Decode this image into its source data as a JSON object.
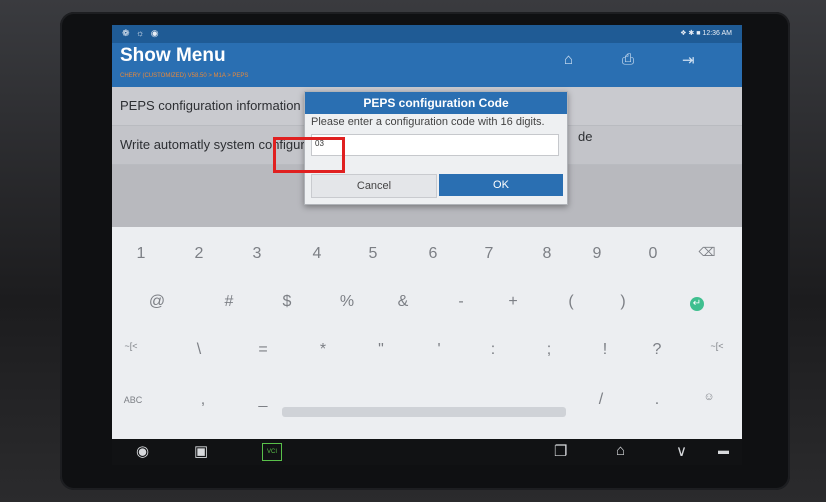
{
  "statusbar": {
    "left_icons": "❁ ☼ ◉",
    "time": "12:36 AM",
    "right_icons": "❖ ✱ ■"
  },
  "header": {
    "title": "Show Menu",
    "breadcrumb": "CHERY (CUSTOMIZED) V58.50 > M1A > PEPS",
    "icons": [
      "home-icon",
      "print-icon",
      "exit-icon"
    ]
  },
  "menu": {
    "items": [
      {
        "label": "PEPS configuration information"
      },
      {
        "label": "Write automatly system configuration"
      }
    ],
    "behind_text": "de"
  },
  "dialog": {
    "title": "PEPS configuration Code",
    "prompt": "Please enter a configuration code with 16 digits.",
    "input_value": "03",
    "cancel_label": "Cancel",
    "ok_label": "OK"
  },
  "keyboard": {
    "row1": [
      "1",
      "2",
      "3",
      "4",
      "5",
      "6",
      "7",
      "8",
      "9",
      "0",
      "⌫"
    ],
    "row2": [
      "@",
      "#",
      "$",
      "%",
      "&",
      "-",
      "+",
      "(",
      ")",
      "↵"
    ],
    "row3": [
      "~[<",
      "\\",
      "=",
      "*",
      "\"",
      "'",
      ":",
      ";",
      "!",
      "?",
      "~[<"
    ],
    "row4": {
      "left": "ABC",
      "comma": ",",
      "underscore": "_",
      "slash": "/",
      "period": ".",
      "emoji": "☺"
    }
  },
  "navbar": {
    "vci_label": "VCI"
  },
  "colors": {
    "accent": "#2a6fb2",
    "highlight": "#e02020",
    "crumb": "#e8893a"
  }
}
